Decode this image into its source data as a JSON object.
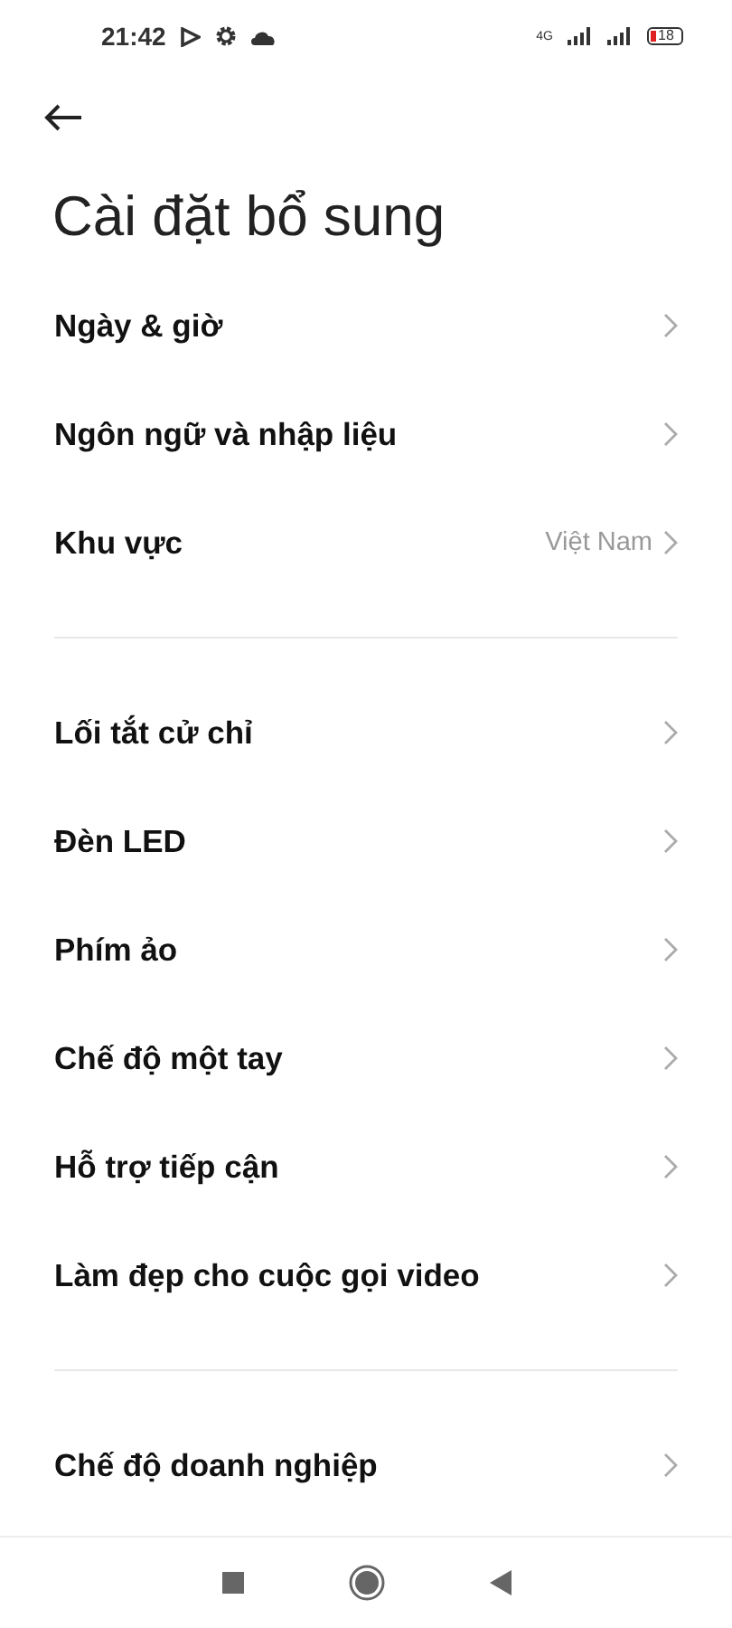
{
  "status_bar": {
    "time": "21:42",
    "network": "4G",
    "battery": "18"
  },
  "title": "Cài đặt bổ sung",
  "sections": [
    {
      "items": [
        {
          "label": "Ngày & giờ"
        },
        {
          "label": "Ngôn ngữ và nhập liệu"
        },
        {
          "label": "Khu vực",
          "value": "Việt Nam"
        }
      ]
    },
    {
      "items": [
        {
          "label": "Lối tắt cử chỉ"
        },
        {
          "label": "Đèn LED"
        },
        {
          "label": "Phím ảo"
        },
        {
          "label": "Chế độ một tay"
        },
        {
          "label": "Hỗ trợ tiếp cận"
        },
        {
          "label": "Làm đẹp cho cuộc gọi video"
        }
      ]
    },
    {
      "items": [
        {
          "label": "Chế độ doanh nghiệp"
        }
      ]
    }
  ]
}
